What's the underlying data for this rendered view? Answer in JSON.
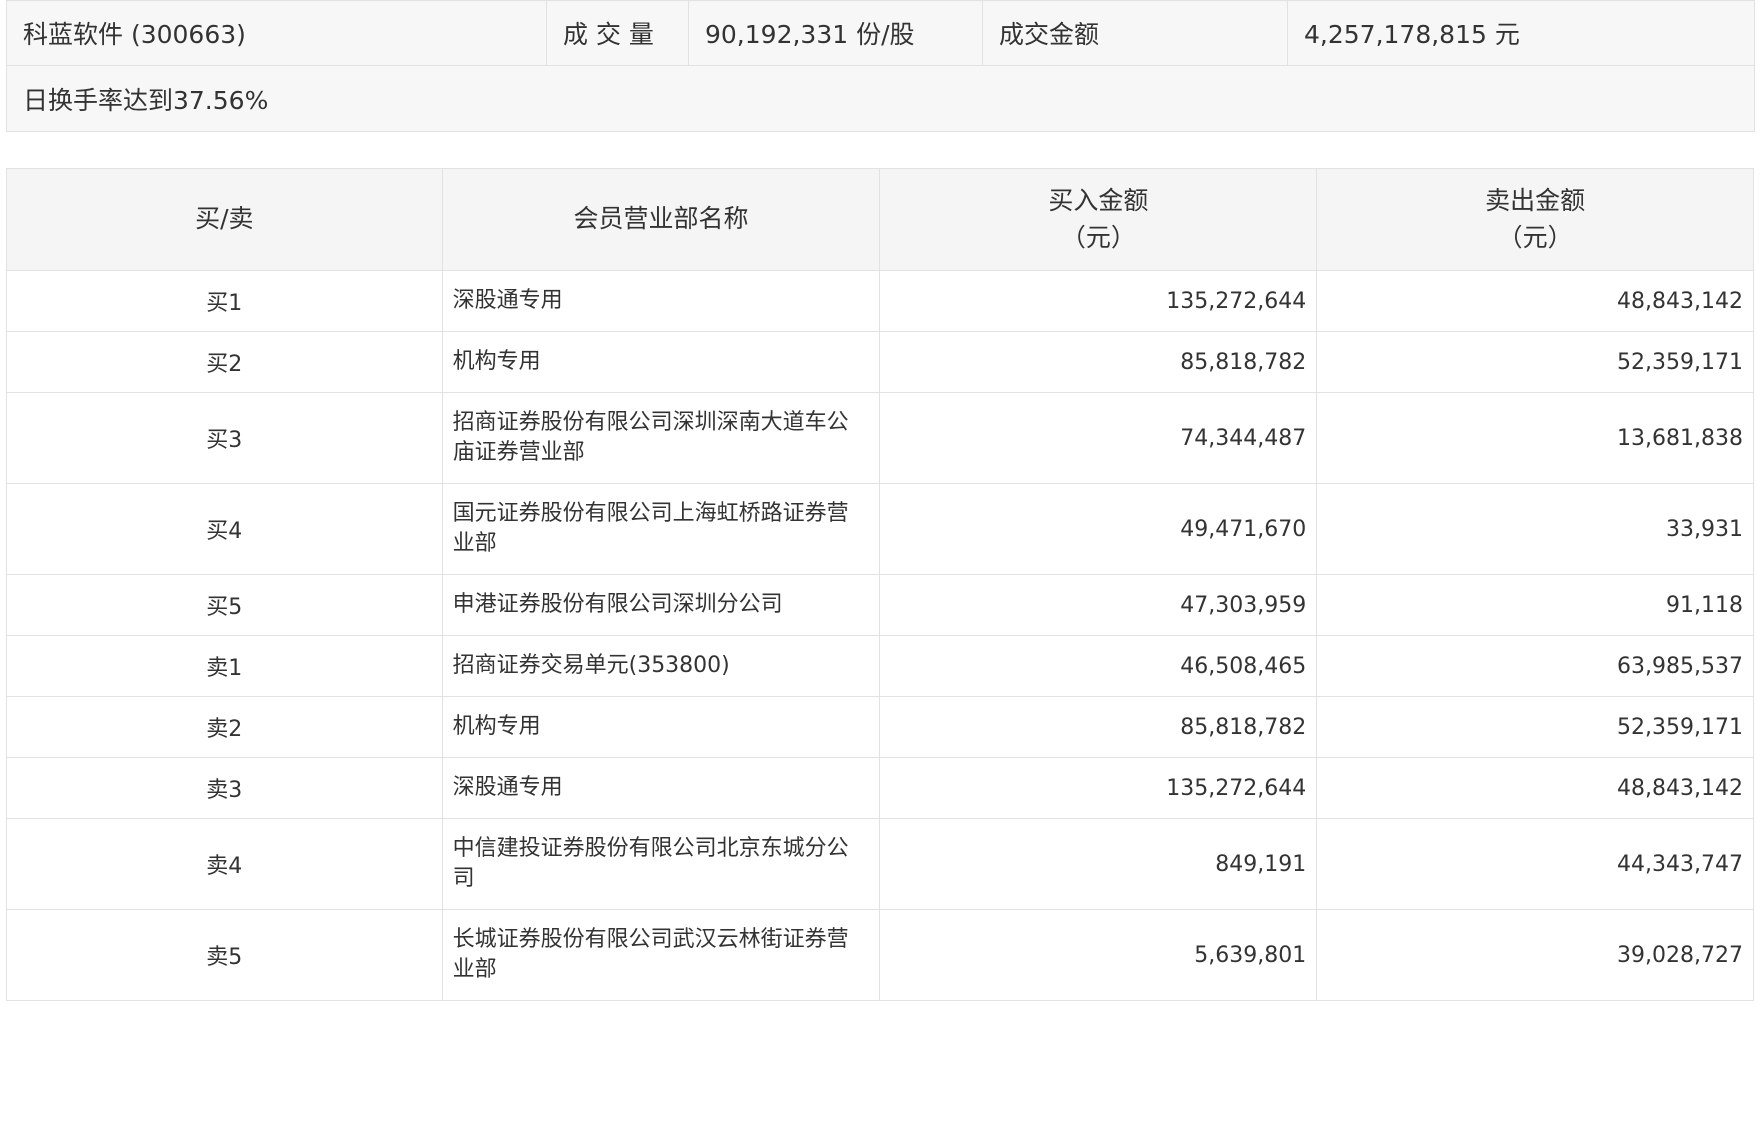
{
  "summary": {
    "stock": "科蓝软件 (300663)",
    "volume_label": "成 交 量",
    "volume_value": "90,192,331 份/股",
    "amount_label": "成交金额",
    "amount_value": "4,257,178,815 元",
    "note": "日换手率达到37.56%"
  },
  "table": {
    "headers": {
      "side": "买/卖",
      "name": "会员营业部名称",
      "buy_line1": "买入金额",
      "buy_line2": "（元）",
      "sell_line1": "卖出金额",
      "sell_line2": "（元）"
    },
    "rows": [
      {
        "side": "买1",
        "name": "深股通专用",
        "buy": "135,272,644",
        "sell": "48,843,142"
      },
      {
        "side": "买2",
        "name": "机构专用",
        "buy": "85,818,782",
        "sell": "52,359,171"
      },
      {
        "side": "买3",
        "name": "招商证券股份有限公司深圳深南大道车公庙证券营业部",
        "buy": "74,344,487",
        "sell": "13,681,838"
      },
      {
        "side": "买4",
        "name": "国元证券股份有限公司上海虹桥路证券营业部",
        "buy": "49,471,670",
        "sell": "33,931"
      },
      {
        "side": "买5",
        "name": "申港证券股份有限公司深圳分公司",
        "buy": "47,303,959",
        "sell": "91,118"
      },
      {
        "side": "卖1",
        "name": "招商证券交易单元(353800)",
        "buy": "46,508,465",
        "sell": "63,985,537"
      },
      {
        "side": "卖2",
        "name": "机构专用",
        "buy": "85,818,782",
        "sell": "52,359,171"
      },
      {
        "side": "卖3",
        "name": "深股通专用",
        "buy": "135,272,644",
        "sell": "48,843,142"
      },
      {
        "side": "卖4",
        "name": "中信建投证券股份有限公司北京东城分公司",
        "buy": "849,191",
        "sell": "44,343,747"
      },
      {
        "side": "卖5",
        "name": "长城证券股份有限公司武汉云林街证券营业部",
        "buy": "5,639,801",
        "sell": "39,028,727"
      }
    ]
  }
}
